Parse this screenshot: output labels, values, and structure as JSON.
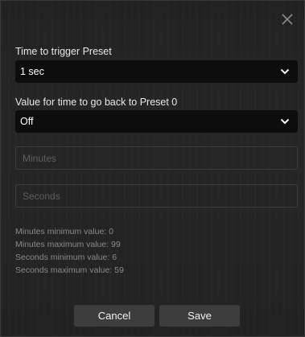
{
  "dialog": {
    "trigger": {
      "label": "Time to trigger Preset",
      "selected": "1 sec"
    },
    "return": {
      "label": "Value for time to go back to Preset 0",
      "selected": "Off"
    },
    "minutes": {
      "value": "",
      "placeholder": "Minutes"
    },
    "seconds": {
      "value": "",
      "placeholder": "Seconds"
    },
    "info": {
      "minutes_min": "Minutes minimum value: 0",
      "minutes_max": "Minutes maximum value: 99",
      "seconds_min": "Seconds minimum value: 6",
      "seconds_max": "Seconds maximum value: 59"
    },
    "buttons": {
      "cancel": "Cancel",
      "save": "Save"
    }
  },
  "icons": {
    "close": "close-icon",
    "dropdown": "chevron-down-icon"
  },
  "colors": {
    "background": "#222222",
    "select_background": "#0d0d0d",
    "button_background": "#3d3d3d",
    "text": "#e8e8e8",
    "muted_text": "#8a8a8a"
  }
}
